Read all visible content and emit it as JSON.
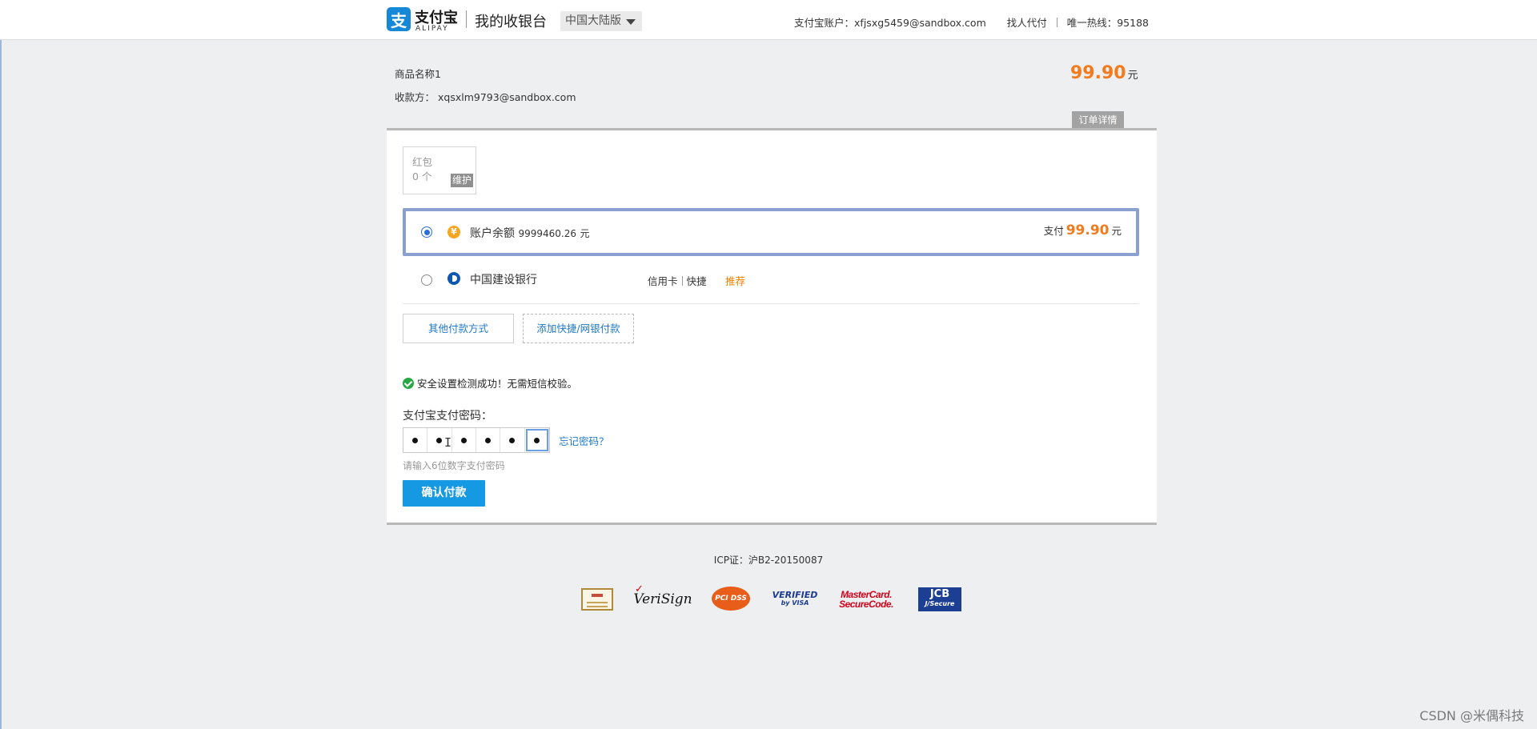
{
  "header": {
    "logo_cn": "支付宝",
    "logo_en": "ALIPAY",
    "title": "我的收银台",
    "region": "中国大陆版",
    "account_label": "支付宝账户：",
    "account_value": "xfjsxg5459@sandbox.com",
    "find_payer": "找人代付",
    "hotline_label": "唯一热线：",
    "hotline_value": "95188"
  },
  "order": {
    "product_name": "商品名称1",
    "payee_label": "收款方：",
    "payee_value": "xqsxlm9793@sandbox.com",
    "amount": "99.90",
    "currency": "元",
    "detail_button": "订单详情"
  },
  "red_packet": {
    "label": "红包",
    "count": "0 个",
    "maintenance": "维护"
  },
  "methods": [
    {
      "label": "账户余额",
      "balance": "9999460.26",
      "currency": "元",
      "pay_label": "支付",
      "pay_amount": "99.90",
      "pay_currency": "元",
      "selected": true
    },
    {
      "label": "中国建设银行",
      "type1": "信用卡",
      "type2": "快捷",
      "recommend": "推荐",
      "selected": false
    }
  ],
  "buttons": {
    "other_methods": "其他付款方式",
    "add_method": "添加快捷/网银付款",
    "confirm": "确认付款"
  },
  "security": {
    "message": "安全设置检测成功！无需短信校验。"
  },
  "password": {
    "label": "支付宝支付密码：",
    "forgot": "忘记密码？",
    "hint": "请输入6位数字支付密码",
    "filled_digits": 6
  },
  "footer": {
    "icp": "ICP证：沪B2-20150087",
    "badges": {
      "verisign": "VeriSign",
      "pci": "PCI DSS",
      "visa_line1": "VERIFIED",
      "visa_line2": "by VISA",
      "mc_line1": "MasterCard.",
      "mc_line2": "SecureCode.",
      "jcb_line1": "JCB",
      "jcb_line2": "J/Secure"
    }
  },
  "watermark": "CSDN @米偶科技",
  "colors": {
    "accent": "#1699e3",
    "amount": "#f37b1d",
    "link": "#1f78c8",
    "selected_border": "#8aa1d0"
  }
}
